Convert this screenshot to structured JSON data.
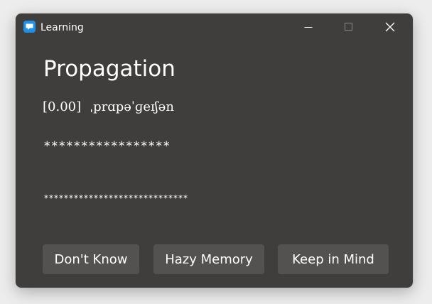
{
  "window": {
    "title": "Learning",
    "icon": "message-app-icon",
    "controls": {
      "minimize_icon": "minimize-icon",
      "maximize_icon": "maximize-icon",
      "close_icon": "close-icon"
    }
  },
  "card": {
    "word": "Propagation",
    "score": "[0.00]",
    "phonetic": "ˌprɑpəˈɡeɪʃən",
    "masked_line_1": "*****************",
    "masked_line_2": "*****************************"
  },
  "actions": {
    "dont_know": "Don't Know",
    "hazy_memory": "Hazy Memory",
    "keep_in_mind": "Keep in Mind"
  },
  "colors": {
    "window_bg": "#403e3c",
    "button_bg": "#545250",
    "accent": "#1e90e8",
    "text": "#ffffff"
  }
}
